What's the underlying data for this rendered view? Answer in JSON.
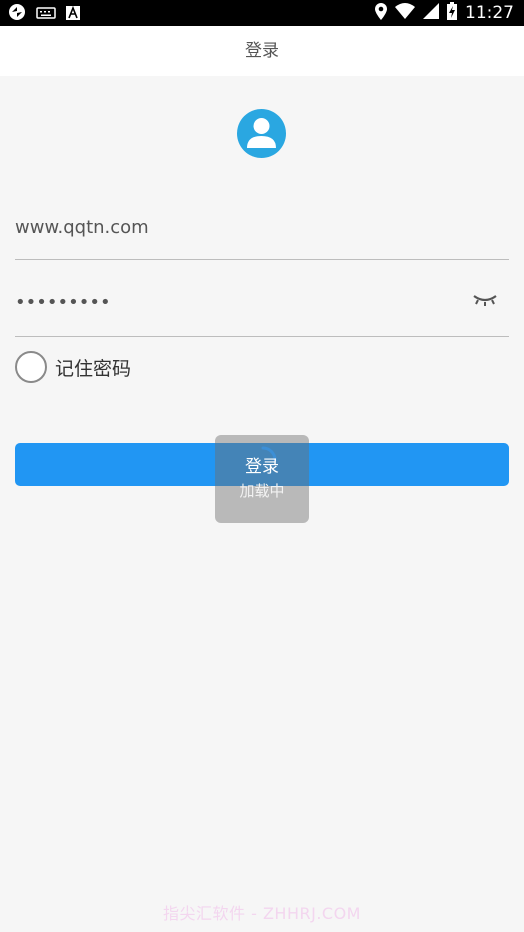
{
  "status_bar": {
    "time": "11:27",
    "left_icons": [
      "sync-icon",
      "keyboard-icon",
      "font-a-icon"
    ],
    "right_icons": [
      "location-icon",
      "wifi-icon",
      "cell-signal-icon",
      "battery-charging-icon"
    ]
  },
  "title_bar": {
    "title": "登录"
  },
  "form": {
    "username_value": "www.qqtn.com",
    "password_value": "•••••••••",
    "remember_label": "记住密码",
    "login_label": "登录"
  },
  "loading": {
    "text": "加载中"
  },
  "watermark": "指尖汇软件 - ZHHRJ.COM",
  "colors": {
    "accent": "#2196f3",
    "avatar": "#2aa7e1",
    "background": "#f6f6f6"
  }
}
